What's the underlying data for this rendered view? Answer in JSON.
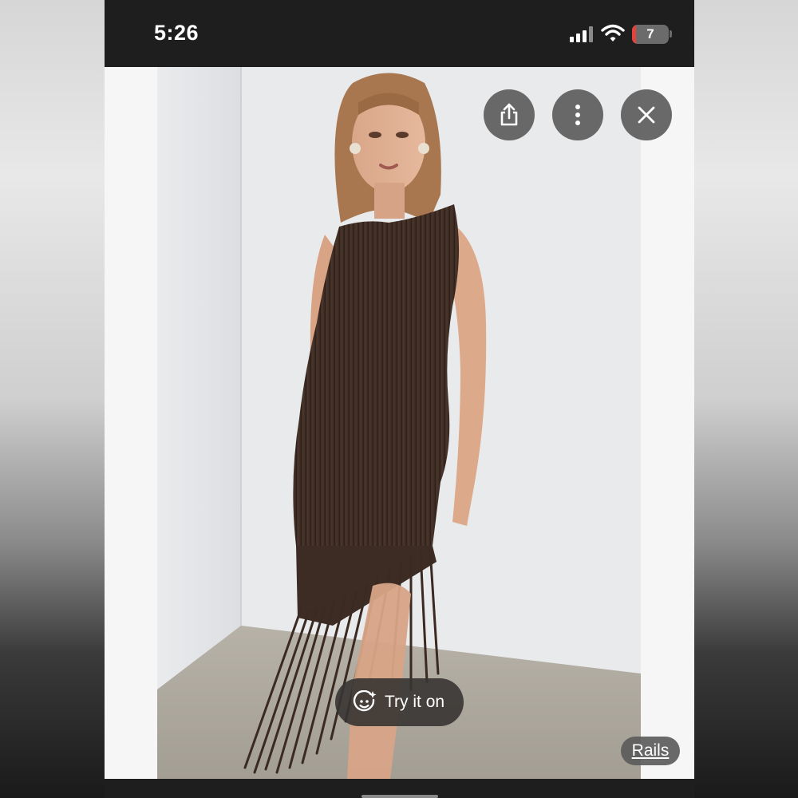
{
  "status_bar": {
    "time": "5:26",
    "battery_level": "7",
    "battery_color": "#e5423b",
    "icons": [
      "signal-bars-icon",
      "wifi-icon",
      "battery-icon"
    ]
  },
  "viewer": {
    "image_description_icon": "product-photo",
    "actions": {
      "share_icon": "share-icon",
      "more_icon": "more-vertical-icon",
      "close_icon": "close-icon"
    },
    "try_on": {
      "label": "Try it on",
      "icon": "sparkle-face-icon"
    },
    "source": {
      "label": "Rails"
    }
  }
}
